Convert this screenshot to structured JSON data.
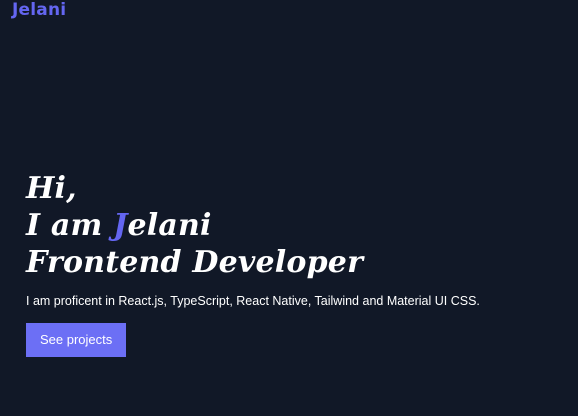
{
  "header": {
    "logo_text": "Jelani"
  },
  "hero": {
    "greeting": "Hi,",
    "intro_prefix": "I am ",
    "name_initial": "J",
    "name_rest": "elani",
    "role": "Frontend Developer",
    "description": "I am proficent in React.js, TypeScript, React Native, Tailwind and Material UI CSS.",
    "cta_label": "See projects"
  },
  "colors": {
    "background": "#111827",
    "accent": "#6466f1",
    "button": "#6c6ff5",
    "text": "#ffffff"
  }
}
